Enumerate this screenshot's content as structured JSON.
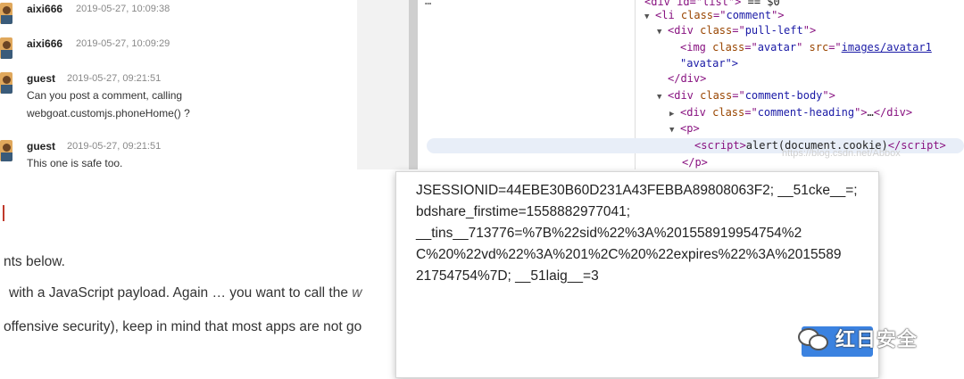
{
  "comments": [
    {
      "user": "aixi666",
      "date": "2019-05-27, 10:09:38",
      "text": []
    },
    {
      "user": "aixi666",
      "date": "2019-05-27, 10:09:29",
      "text": []
    },
    {
      "user": "guest",
      "date": "2019-05-27, 09:21:51",
      "text": [
        "Can you post a comment, calling",
        "webgoat.customjs.phoneHome() ?"
      ]
    },
    {
      "user": "guest",
      "date": "2019-05-27, 09:21:51",
      "text": [
        "This one is safe too."
      ]
    }
  ],
  "devtools": {
    "top_partial": "…",
    "li_class": "comment",
    "pull_left_class": "pull-left",
    "img_class": "avatar",
    "img_src": "images/avatar1",
    "img_alt": "\"avatar\">",
    "comment_body_class": "comment-body",
    "comment_heading_class": "comment-heading",
    "script_content": "alert(document.cookie)",
    "watermark": "https://blog.csdn.net/Abbox"
  },
  "alert": {
    "cookie_lines": [
      "JSESSIONID=44EBE30B60D231A43FEBBA89808063F2; __51cke__=;",
      "bdshare_firstime=1558882977041;",
      "__tins__713776=%7B%22sid%22%3A%201558919954754%2",
      "C%20%22vd%22%3A%201%2C%20%22expires%22%3A%2015589",
      "21754754%7D; __51laig__=3"
    ]
  },
  "lesson": {
    "line1": "nts below.",
    "line2": "with a JavaScript payload. Again … you want to call the",
    "line2_italic": "w",
    "line3": "offensive security), keep in mind that most apps are not go"
  },
  "brand": {
    "label": "红日安全",
    "icon": "wechat-icon"
  }
}
